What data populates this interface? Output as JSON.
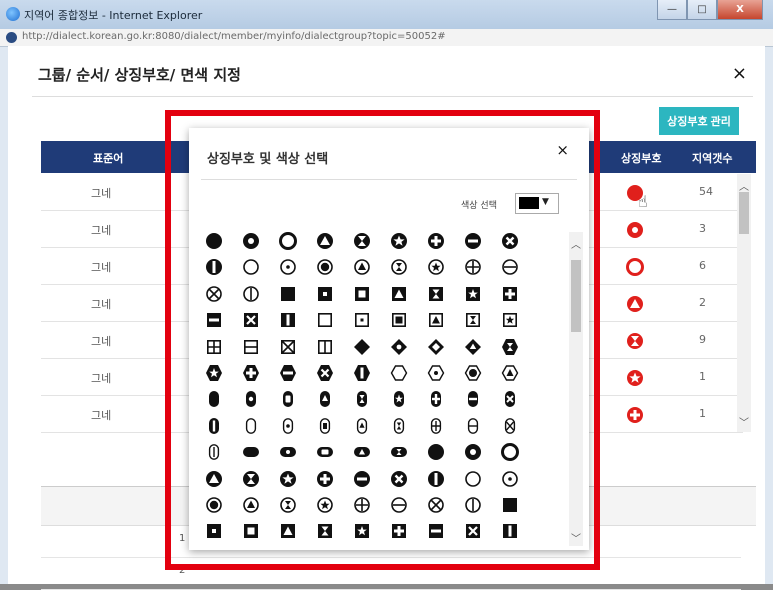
{
  "window": {
    "title": "지역어 종합정보 - Internet Explorer",
    "url": "http://dialect.korean.go.kr:8080/dialect/member/myinfo/dialectgroup?topic=50052#",
    "minimize": "—",
    "maximize": "□",
    "close": "X"
  },
  "page": {
    "title": "그룹/ 순서/ 상징부호/ 면색 지정",
    "close": "×",
    "manage_button": "상징부호 관리",
    "columns": {
      "standard": "표준어",
      "symbol": "상징부호",
      "count": "지역갯수"
    },
    "rows": [
      {
        "word": "그네",
        "count": "54"
      },
      {
        "word": "그네",
        "count": "3"
      },
      {
        "word": "그네",
        "count": "6"
      },
      {
        "word": "그네",
        "count": "2"
      },
      {
        "word": "그네",
        "count": "9"
      },
      {
        "word": "그네",
        "count": "1"
      },
      {
        "word": "그네",
        "count": "1"
      }
    ],
    "bottom_rows": [
      {
        "num": "1"
      },
      {
        "num": "2"
      }
    ]
  },
  "dialog": {
    "title": "상징부호 및 색상 선택",
    "close": "×",
    "color_label": "색상 선택",
    "color_arrow": "▼"
  },
  "colors": {
    "accent": "#2cb6c0",
    "header": "#1f3b78",
    "highlight": "#e3000f",
    "symbol_red": "#e0201c"
  }
}
